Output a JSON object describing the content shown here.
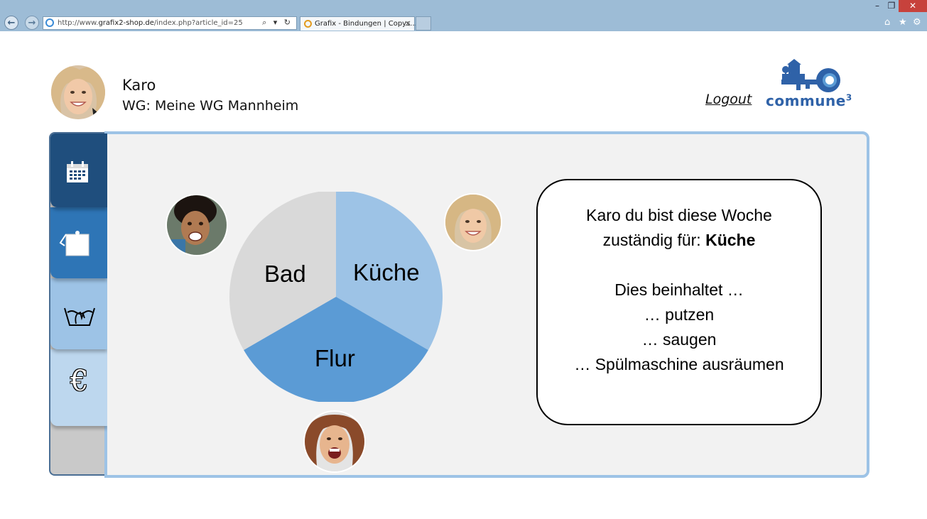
{
  "browser": {
    "url_prefix": "http://www.",
    "url_domain": "grafix2-shop.de",
    "url_path": "/index.php?article_id=25",
    "tab_title": "Grafix - Bindungen | Copys...",
    "tab_close": "×",
    "address_tools": "⌕ ▾ ↻",
    "window_buttons": [
      "–",
      "❐",
      "✕"
    ],
    "right_tools": [
      "⌂",
      "★",
      "⚙"
    ]
  },
  "header": {
    "username": "Karo",
    "wg": "WG: Meine WG Mannheim",
    "logout": "Logout",
    "brand": "commune",
    "brand_sup": "3",
    "brand_color": "#2f62a8"
  },
  "sidebar": {
    "items": [
      {
        "icon": "calendar-icon",
        "color": "#1f4e7d"
      },
      {
        "icon": "notepad-icon",
        "color": "#2e75b6"
      },
      {
        "icon": "laundry-icon",
        "color": "#9dc3e6"
      },
      {
        "icon": "euro-icon",
        "color": "#bdd7ee",
        "glyph": "€"
      }
    ]
  },
  "chores": {
    "segments": [
      {
        "label": "Küche",
        "value": 1,
        "color": "#9dc3e6"
      },
      {
        "label": "Flur",
        "value": 1,
        "color": "#5b9bd5"
      },
      {
        "label": "Bad",
        "value": 1,
        "color": "#d9d9d9"
      }
    ]
  },
  "info": {
    "line1": "Karo du bist diese Woche",
    "line2_prefix": "zuständig für: ",
    "line2_bold": "Küche",
    "line3": "Dies beinhaltet …",
    "line4": "… putzen",
    "line5": "… saugen",
    "line6": "… Spülmaschine ausräumen"
  }
}
